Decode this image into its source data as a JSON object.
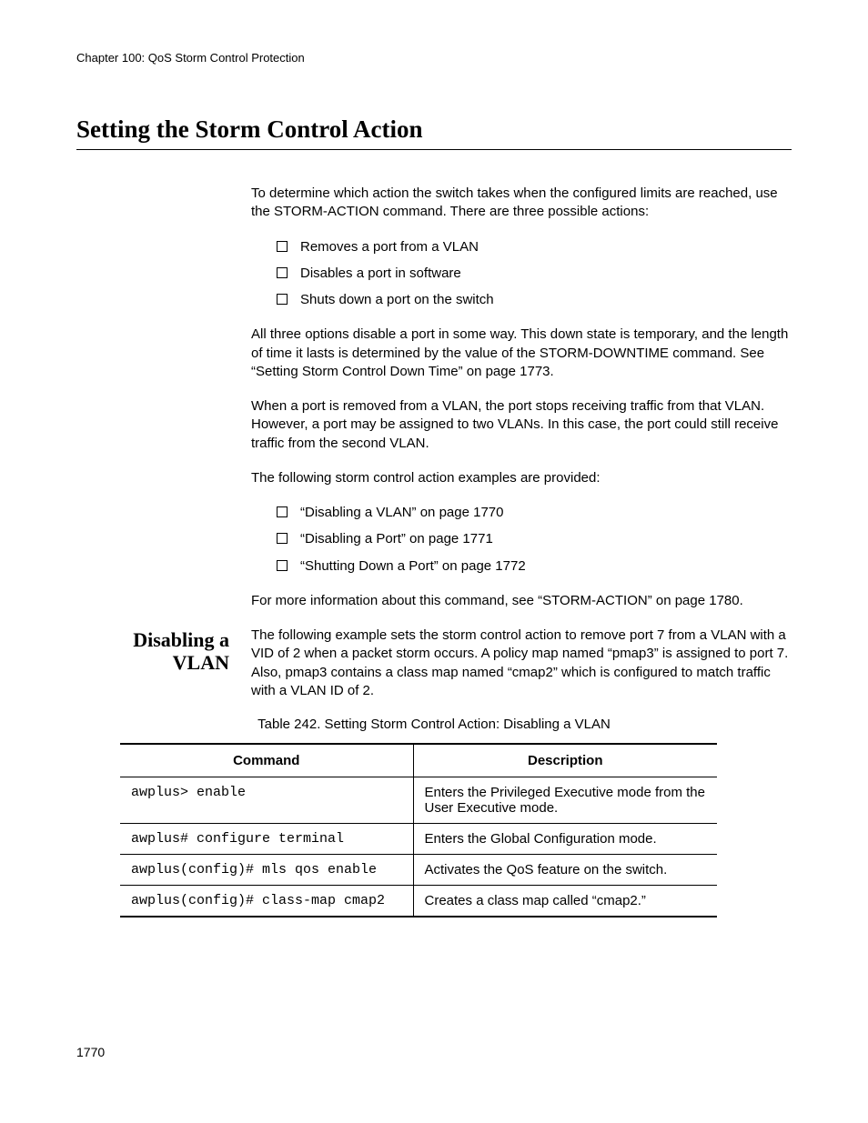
{
  "chapter_header": "Chapter 100: QoS Storm Control Protection",
  "title": "Setting the Storm Control Action",
  "intro_para": "To determine which action the switch takes when the configured limits are reached, use the STORM-ACTION command. There are three possible actions:",
  "action_list": [
    "Removes a port from a VLAN",
    "Disables a port in software",
    "Shuts down a port on the switch"
  ],
  "para2": "All three options disable a port in some way. This down state is temporary, and the length of time it lasts is determined by the value of the STORM-DOWNTIME command. See “Setting Storm Control Down Time” on page 1773.",
  "para3": "When a port is removed from a VLAN, the port stops receiving traffic from that VLAN. However, a port may be assigned to two VLANs. In this case, the port could still receive traffic from the second VLAN.",
  "para4": "The following storm control action examples are provided:",
  "example_list": [
    "“Disabling a VLAN” on page 1770",
    "“Disabling a Port” on page 1771",
    "“Shutting Down a Port” on page 1772"
  ],
  "para5": "For more information about this command, see “STORM-ACTION” on page 1780.",
  "section2": {
    "heading_line1": "Disabling a",
    "heading_line2": "VLAN",
    "body": "The following example sets the storm control action to remove port 7 from a VLAN with a VID of 2 when a packet storm occurs. A policy map named “pmap3” is assigned to port 7. Also, pmap3 contains a class map named “cmap2” which is configured to match traffic with a VLAN ID of 2."
  },
  "table": {
    "caption": "Table 242. Setting Storm Control Action: Disabling a VLAN",
    "head_col1": "Command",
    "head_col2": "Description",
    "rows": [
      {
        "cmd": "awplus> enable",
        "desc": "Enters the Privileged Executive mode from the User Executive mode."
      },
      {
        "cmd": "awplus# configure terminal",
        "desc": "Enters the Global Configuration mode."
      },
      {
        "cmd": "awplus(config)# mls qos enable",
        "desc": "Activates the QoS feature on the switch."
      },
      {
        "cmd": "awplus(config)# class-map cmap2",
        "desc": "Creates a class map called “cmap2.”"
      }
    ]
  },
  "page_number": "1770"
}
